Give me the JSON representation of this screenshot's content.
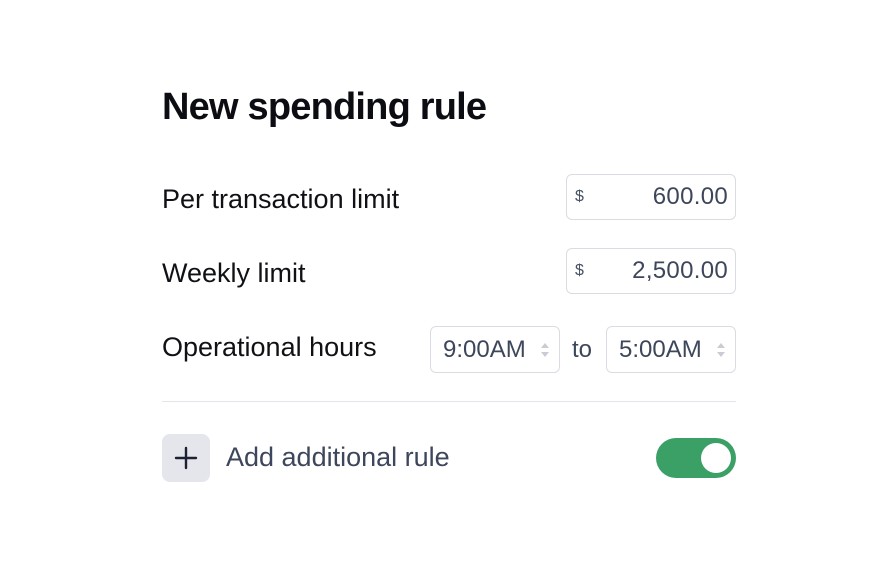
{
  "form": {
    "title": "New spending rule",
    "per_transaction": {
      "label": "Per transaction limit",
      "currency": "$",
      "value": "600.00"
    },
    "weekly": {
      "label": "Weekly limit",
      "currency": "$",
      "value": "2,500.00"
    },
    "hours": {
      "label": "Operational hours",
      "start": "9:00AM",
      "separator": "to",
      "end": "5:00AM"
    },
    "add_rule": {
      "label": "Add additional rule",
      "icon": "plus-icon"
    },
    "toggle": {
      "state": "on",
      "color": "#3aa066"
    }
  }
}
